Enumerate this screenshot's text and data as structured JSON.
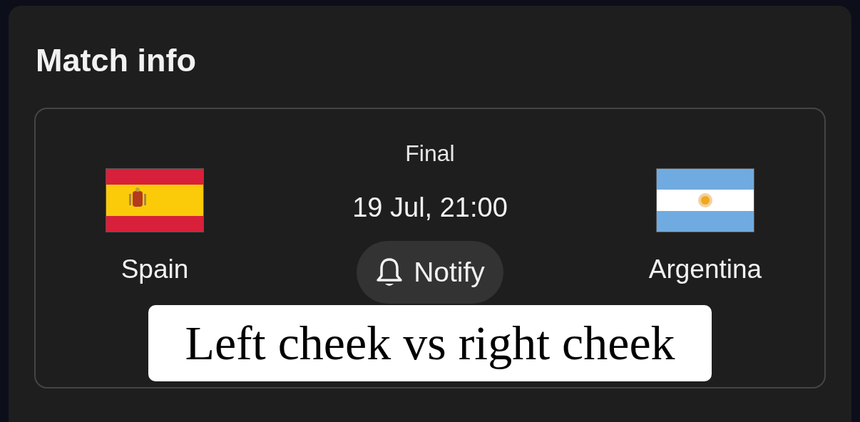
{
  "title": "Match info",
  "match": {
    "home": {
      "name": "Spain"
    },
    "status": "Final",
    "datetime": "19 Jul, 21:00",
    "notify_button": "Notify",
    "away": {
      "name": "Argentina"
    }
  },
  "caption": "Left cheek vs right cheek"
}
